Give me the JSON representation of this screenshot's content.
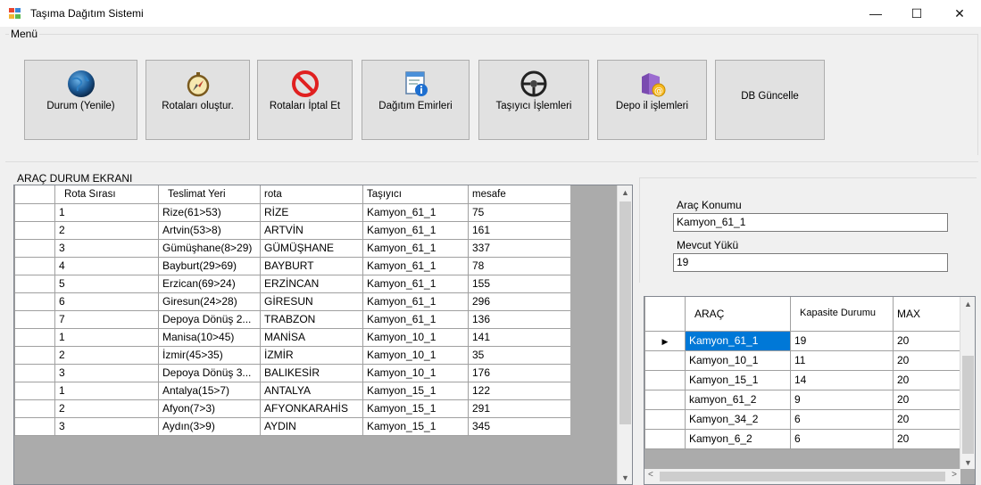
{
  "window": {
    "title": "Taşıma Dağıtım Sistemi",
    "minimize": "—",
    "maximize": "☐",
    "close": "✕"
  },
  "menu": {
    "legend": "Menü",
    "buttons": [
      {
        "label": "Durum (Yenile)",
        "icon": "globe-icon"
      },
      {
        "label": "Rotaları oluştur.",
        "icon": "compass-icon"
      },
      {
        "label": "Rotaları İptal Et",
        "icon": "cancel-icon"
      },
      {
        "label": "Dağıtım Emirleri",
        "icon": "document-info-icon"
      },
      {
        "label": "Taşıyıcı İşlemleri",
        "icon": "steering-wheel-icon"
      },
      {
        "label": "Depo il işlemleri",
        "icon": "folder-mail-icon"
      },
      {
        "label": "DB Güncelle",
        "icon": ""
      }
    ]
  },
  "arac_panel": {
    "legend": "ARAÇ DURUM EKRANI",
    "columns": [
      "Rota Sırası",
      "Teslimat Yeri",
      "rota",
      "Taşıyıcı",
      "mesafe"
    ],
    "rows": [
      [
        "1",
        "Rize(61>53)",
        "RİZE",
        "Kamyon_61_1",
        "75"
      ],
      [
        "2",
        "Artvin(53>8)",
        "ARTVİN",
        "Kamyon_61_1",
        "161"
      ],
      [
        "3",
        "Gümüşhane(8>29)",
        "GÜMÜŞHANE",
        "Kamyon_61_1",
        "337"
      ],
      [
        "4",
        "Bayburt(29>69)",
        "BAYBURT",
        "Kamyon_61_1",
        "78"
      ],
      [
        "5",
        "Erzican(69>24)",
        "ERZİNCAN",
        "Kamyon_61_1",
        "155"
      ],
      [
        "6",
        "Giresun(24>28)",
        "GİRESUN",
        "Kamyon_61_1",
        "296"
      ],
      [
        "7",
        "Depoya Dönüş 2...",
        "TRABZON",
        "Kamyon_61_1",
        "136"
      ],
      [
        "1",
        "Manisa(10>45)",
        "MANİSA",
        "Kamyon_10_1",
        "141"
      ],
      [
        "2",
        "İzmir(45>35)",
        "İZMİR",
        "Kamyon_10_1",
        "35"
      ],
      [
        "3",
        "Depoya Dönüş 3...",
        "BALIKESİR",
        "Kamyon_10_1",
        "176"
      ],
      [
        "1",
        "Antalya(15>7)",
        "ANTALYA",
        "Kamyon_15_1",
        "122"
      ],
      [
        "2",
        "Afyon(7>3)",
        "AFYONKARAHİS",
        "Kamyon_15_1",
        "291"
      ],
      [
        "3",
        "Aydın(3>9)",
        "AYDIN",
        "Kamyon_15_1",
        "345"
      ]
    ]
  },
  "vehicle_info": {
    "konum_label": "Araç Konumu",
    "konum_value": "Kamyon_61_1",
    "yuk_label": "Mevcut Yükü",
    "yuk_value": "19"
  },
  "capacity_grid": {
    "columns": [
      "ARAÇ",
      "Kapasite Durumu",
      "MAX"
    ],
    "rows": [
      [
        "Kamyon_61_1",
        "19",
        "20"
      ],
      [
        "Kamyon_10_1",
        "11",
        "20"
      ],
      [
        "Kamyon_15_1",
        "14",
        "20"
      ],
      [
        "kamyon_61_2",
        "9",
        "20"
      ],
      [
        "Kamyon_34_2",
        "6",
        "20"
      ],
      [
        "Kamyon_6_2",
        "6",
        "20"
      ]
    ],
    "selected_row": 0
  },
  "colors": {
    "selection": "#0078d7",
    "button_face": "#e1e1e1",
    "grid_background": "#ababab"
  }
}
